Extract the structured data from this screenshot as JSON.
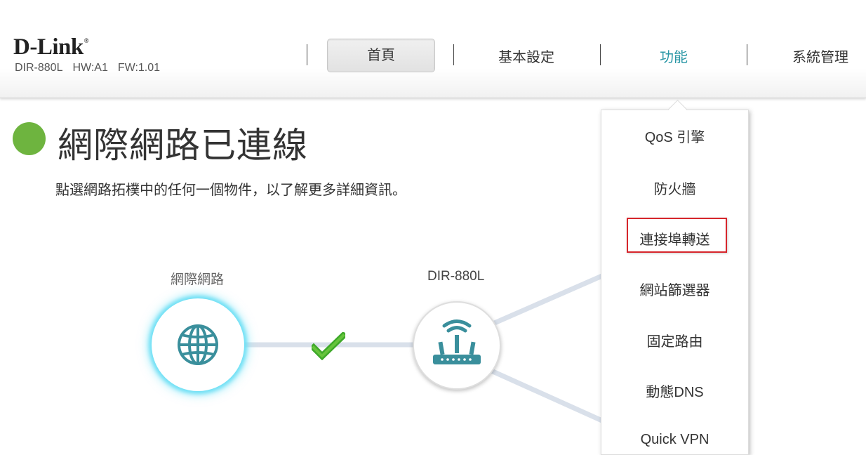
{
  "header": {
    "brand": "D-Link",
    "brand_mark": "®",
    "model": "DIR-880L",
    "hw": "HW:A1",
    "fw": "FW:1.01"
  },
  "nav": {
    "home": "首頁",
    "basic_settings": "基本設定",
    "features": "功能",
    "management": "系統管理",
    "active": "features",
    "accent_color": "#2a97a6"
  },
  "status": {
    "title": "網際網路已連線",
    "subtitle": "點選網路拓樸中的任何一個物件，以了解更多詳細資訊。",
    "color": "#6eb43f"
  },
  "topology": {
    "internet_label": "網際網路",
    "router_label": "DIR-880L",
    "internet_icon": "globe-icon",
    "router_icon": "router-icon",
    "link_status_icon": "checkmark-icon"
  },
  "dropdown": {
    "items": [
      {
        "label": "QoS 引擎"
      },
      {
        "label": "防火牆"
      },
      {
        "label": "連接埠轉送"
      },
      {
        "label": "網站篩選器"
      },
      {
        "label": "固定路由"
      },
      {
        "label": "動態DNS"
      },
      {
        "label": "Quick VPN"
      }
    ],
    "highlighted_index": 2,
    "highlight_color": "#d6262c"
  }
}
